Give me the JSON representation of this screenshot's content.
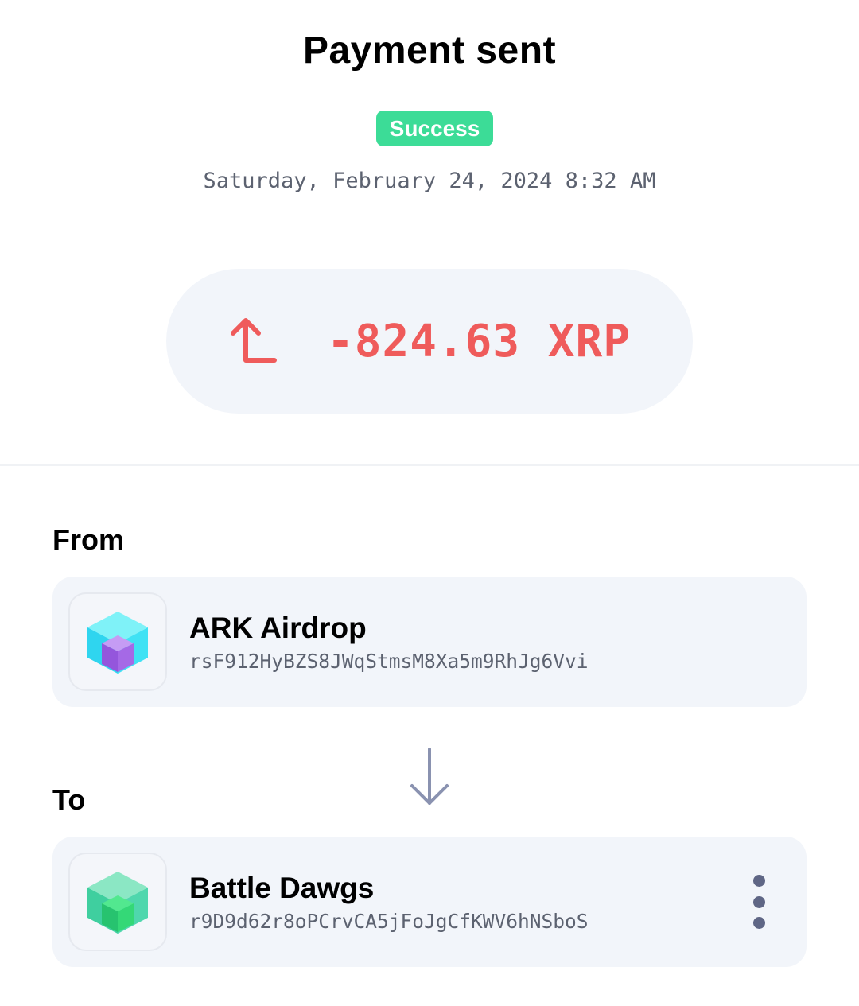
{
  "header": {
    "title": "Payment sent",
    "status": "Success",
    "date": "Saturday, February 24, 2024 8:32 AM"
  },
  "amount": {
    "value": "-824.63 XRP",
    "direction_icon": "arrow-up-left-icon"
  },
  "from": {
    "label": "From",
    "name": "ARK Airdrop",
    "address": "rsF912HyBZS8JWqStmsM8Xa5m9RhJg6Vvi",
    "avatar_icon": "cube-icon"
  },
  "to": {
    "label": "To",
    "name": "Battle Dawgs",
    "address": "r9D9d62r8oPCrvCA5jFoJgCfKWV6hNSboS",
    "avatar_icon": "cube-icon",
    "menu_icon": "more-vertical-icon"
  },
  "colors": {
    "success": "#3cdc97",
    "debit": "#ef5b5b",
    "card_bg": "#f2f5fa",
    "muted": "#5c6270"
  }
}
